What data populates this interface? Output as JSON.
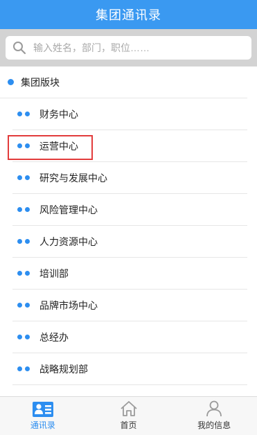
{
  "header": {
    "title": "集团通讯录"
  },
  "search": {
    "placeholder": "输入姓名，部门，职位……"
  },
  "tree": {
    "root_label": "集团版块",
    "departments": [
      "财务中心",
      "运营中心",
      "研究与发展中心",
      "风险管理中心",
      "人力资源中心",
      "培训部",
      "品牌市场中心",
      "总经办",
      "战略规划部"
    ],
    "highlighted": "运营中心"
  },
  "tabbar": {
    "tabs": [
      {
        "label": "通讯录",
        "icon": "contacts-icon",
        "active": true
      },
      {
        "label": "首页",
        "icon": "home-icon",
        "active": false
      },
      {
        "label": "我的信息",
        "icon": "user-icon",
        "active": false
      }
    ]
  },
  "colors": {
    "accent": "#3a99f1",
    "dot": "#2d8ef0",
    "highlight": "#e23b3b"
  }
}
